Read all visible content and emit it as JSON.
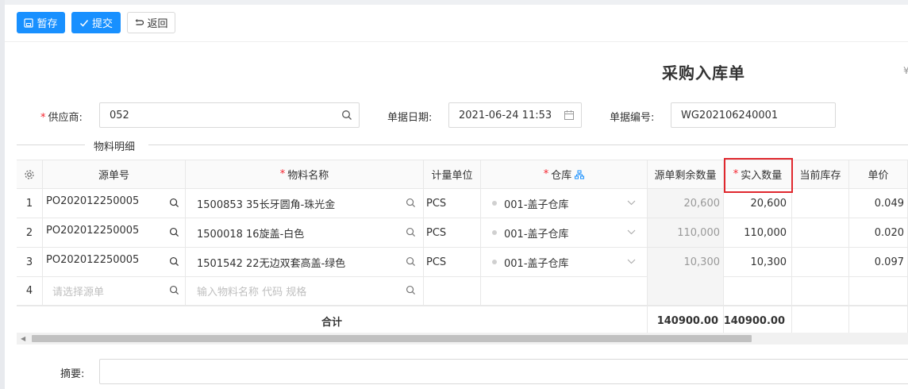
{
  "toolbar": {
    "save_label": "暂存",
    "submit_label": "提交",
    "back_label": "返回"
  },
  "form": {
    "title": "采购入库单",
    "corner_text": "¥",
    "supplier_label": "供应商:",
    "supplier_value": "052",
    "date_label": "单据日期:",
    "date_value": "2021-06-24 11:53",
    "number_label": "单据编号:",
    "number_value": "WG202106240001"
  },
  "section": {
    "title": "物料明细"
  },
  "table": {
    "headers": {
      "source_no": "源单号",
      "material": "物料名称",
      "unit": "计量单位",
      "warehouse": "仓库",
      "remaining": "源单剩余数量",
      "actual_qty": "实入数量",
      "stock": "当前库存",
      "price": "单价"
    },
    "rows": [
      {
        "idx": "1",
        "source_no": "PO202012250005",
        "material": "1500853  35长牙圆角-珠光金",
        "unit": "PCS",
        "warehouse": "001-盖子仓库",
        "remaining": "20,600",
        "actual_qty": "20,600",
        "stock": "",
        "price": "0.049"
      },
      {
        "idx": "2",
        "source_no": "PO202012250005",
        "material": "1500018  16旋盖-白色",
        "unit": "PCS",
        "warehouse": "001-盖子仓库",
        "remaining": "110,000",
        "actual_qty": "110,000",
        "stock": "",
        "price": "0.020"
      },
      {
        "idx": "3",
        "source_no": "PO202012250005",
        "material": "1501542  22无边双套高盖-绿色",
        "unit": "PCS",
        "warehouse": "001-盖子仓库",
        "remaining": "10,300",
        "actual_qty": "10,300",
        "stock": "",
        "price": "0.097"
      }
    ],
    "empty_row": {
      "idx": "4",
      "source_placeholder": "请选择源单",
      "material_placeholder": "输入物料名称 代码 规格"
    },
    "summary": {
      "label": "合计",
      "remaining_total": "140900.00",
      "actual_total": "140900.00"
    }
  },
  "remark": {
    "label": "摘要:"
  },
  "colors": {
    "primary": "#1890ff",
    "required": "#f5222d",
    "highlight": "#e0282e"
  }
}
